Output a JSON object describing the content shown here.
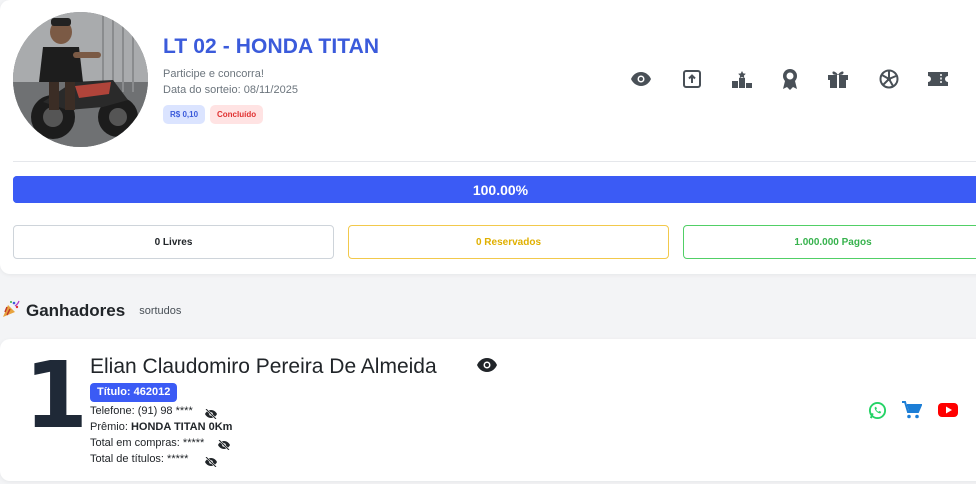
{
  "raffle": {
    "title": "LT 02 - HONDA TITAN",
    "subtitle": "Participe e concorra!",
    "draw_date": "Data do sorteio: 08/11/2025",
    "price_badge": "R$ 0,10",
    "status_badge": "Concluído"
  },
  "toolbar": {
    "icons": [
      "eye-icon",
      "share-icon",
      "podium-icon",
      "award-icon",
      "gift-icon",
      "wheel-icon",
      "ticket-icon"
    ]
  },
  "progress": {
    "value": 1.0,
    "label": "100.00%"
  },
  "stats": {
    "free": "0 Livres",
    "reserved": "0 Reservados",
    "paid": "1.000.000 Pagos"
  },
  "winners": {
    "heading": "Ganhadores",
    "subheading": "sortudos",
    "items": [
      {
        "rank": "1",
        "name": "Elian Claudomiro Pereira De Almeida",
        "ticket": "Título: 462012",
        "phone": "Telefone: (91) 98 ****",
        "prize_label": "Prêmio:",
        "prize_value": "HONDA TITAN 0Km",
        "purchases": "Total em compras: *****",
        "titles": "Total de títulos: *****"
      }
    ]
  },
  "colors": {
    "accent": "#3b5bdb",
    "progress": "#3b5bf5",
    "reserved": "#f2c94c",
    "paid": "#51cf66",
    "whatsapp": "#25d366",
    "cart": "#1c7ed6",
    "youtube": "#ff0000"
  }
}
